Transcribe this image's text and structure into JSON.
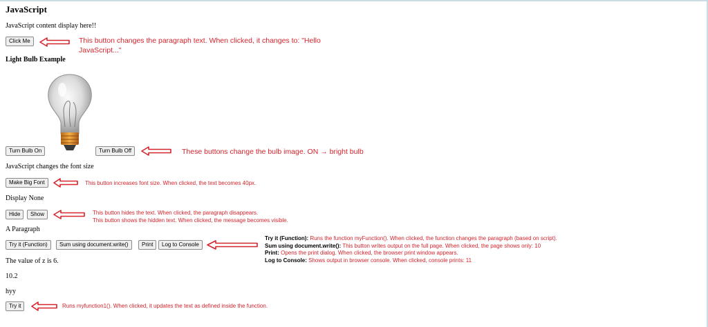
{
  "page": {
    "heading": "JavaScript",
    "intro_text": "JavaScript content display here!!",
    "click_me_label": "Click Me",
    "bulb_heading": "Light Bulb Example",
    "bulb_on_label": "Turn Bulb On",
    "bulb_off_label": "Turn Bulb Off",
    "font_size_text": "JavaScript changes the font size",
    "big_font_label": "Make Big Font",
    "display_none_text": "Display None",
    "hide_label": "Hide",
    "show_label": "Show",
    "paragraph_text": "A Paragraph",
    "try_function_label": "Try it (Function)",
    "sum_write_label": "Sum using document.write()",
    "print_label": "Print",
    "log_console_label": "Log to Console",
    "z_value_text": "The value of z is 6.",
    "number_text": "10.2",
    "hyy_text": "hyy",
    "try_it_label": "Try it"
  },
  "annotations": {
    "click_me_line1": "This button changes the paragraph text. When clicked, it changes to: \"Hello",
    "click_me_line2": "JavaScript...\"",
    "bulb_note": "These buttons change the bulb image. ON → bright bulb",
    "font_note": "This button increases font size. When clicked, the text becomes 40px.",
    "hide_note": "This button hides the text. When clicked, the paragraph disappears.",
    "show_note": "This button shows the hidden text. When clicked, the message becomes visible.",
    "functions": [
      {
        "term": "Try it (Function):",
        "desc": " Runs the function myFunction(). When clicked, the function changes the paragraph (based on script)."
      },
      {
        "term": "Sum using document.write():",
        "desc": " This button writes output on the full page. When clicked, the page shows only: 10"
      },
      {
        "term": "Print:",
        "desc": " Opens the print dialog. When clicked, the browser print window appears."
      },
      {
        "term": "Log to Console:",
        "desc": " Shows output in browser console. When clicked, console prints: 11"
      }
    ],
    "try_it_note": "Runs myfunction1(). When clicked, it updates the text as defined inside the function."
  },
  "colors": {
    "annotation_red": "#d7232b",
    "button_bg": "#efefef",
    "frame": "#c9dde3"
  },
  "icons": {
    "arrow": "left-arrow-icon",
    "bulb": "light-bulb-icon"
  }
}
